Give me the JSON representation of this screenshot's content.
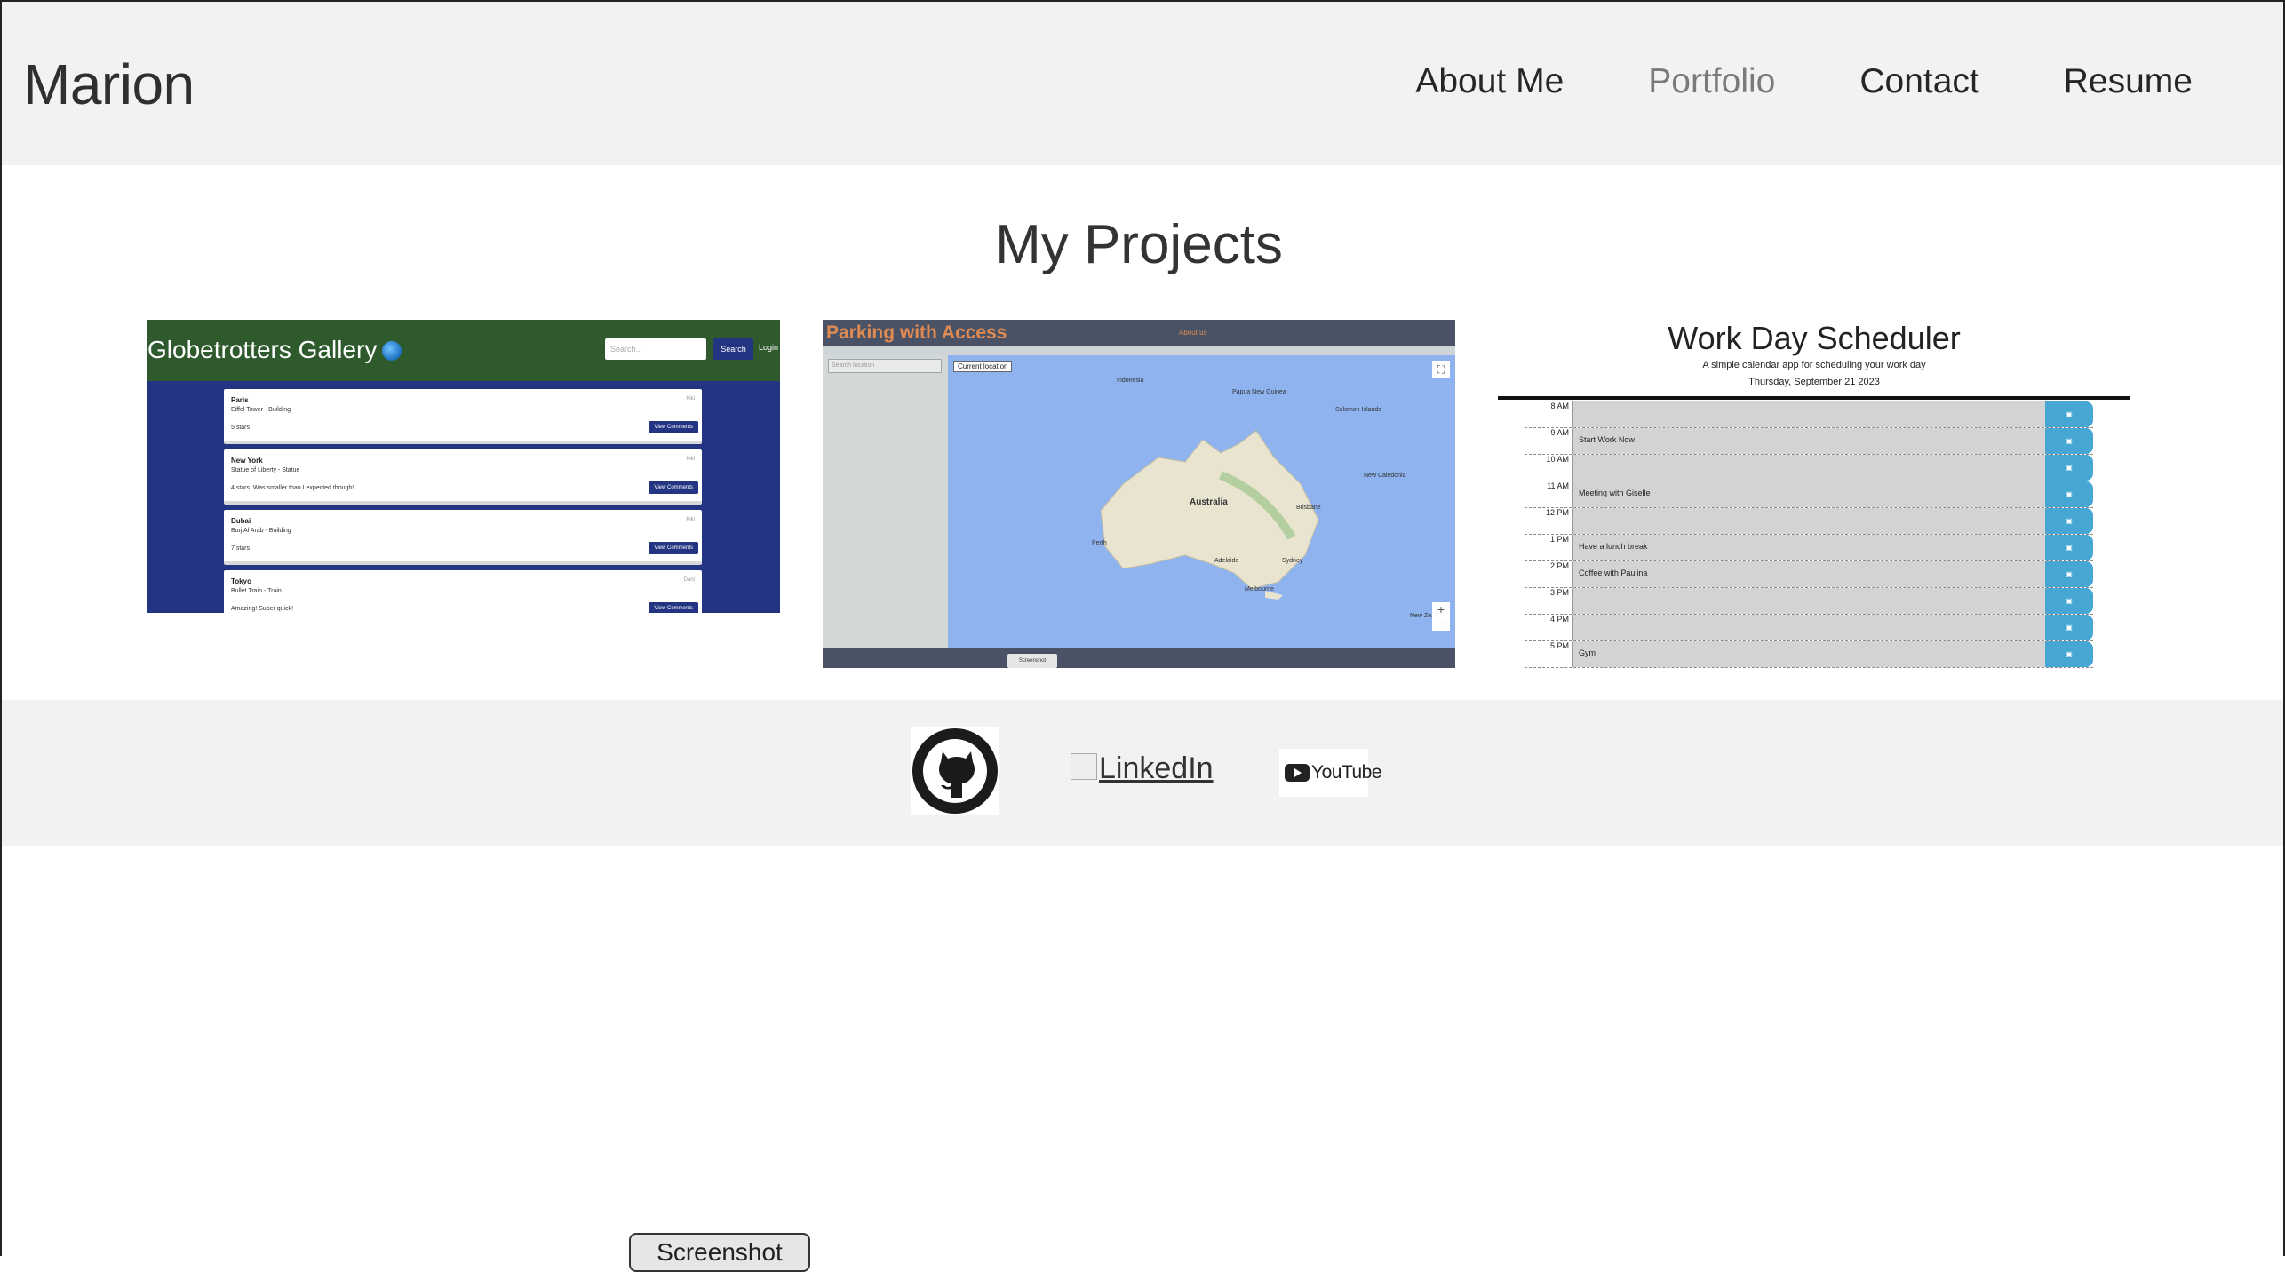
{
  "brand": "Marion",
  "nav": {
    "about": "About Me",
    "portfolio": "Portfolio",
    "contact": "Contact",
    "resume": "Resume",
    "active": "Portfolio",
    "active_color": "#7a7a7a"
  },
  "projects": {
    "heading": "My Projects",
    "globetrotters": {
      "title": "Globetrotters Gallery",
      "search_placeholder": "Search...",
      "search_button": "Search",
      "login": "Login",
      "items": [
        {
          "city": "Paris",
          "subtitle": "Eiffel Tower - Building",
          "review": "5 stars",
          "author": "Kiki",
          "button": "View Comments"
        },
        {
          "city": "New York",
          "subtitle": "Statue of Liberty - Statue",
          "review": "4 stars. Was smaller than I expected though!",
          "author": "Kiki",
          "button": "View Comments"
        },
        {
          "city": "Dubai",
          "subtitle": "Burj Al Arab - Building",
          "review": "7 stars",
          "author": "Kiki",
          "button": "View Comments"
        },
        {
          "city": "Tokyo",
          "subtitle": "Bullet Train - Train",
          "review": "Amazing! Super quick!",
          "author": "Dani",
          "button": "View Comments"
        }
      ]
    },
    "parking": {
      "title": "Parking with Access",
      "about": "About us",
      "search_placeholder": "Search location",
      "current_location": "Current location",
      "map_labels": [
        "Indonesia",
        "Papua New Guinea",
        "Solomon Islands",
        "Australia",
        "New Caledonia",
        "New Zealand",
        "Sydney",
        "Brisbane",
        "Perth",
        "Adelaide",
        "Melbourne"
      ],
      "screenshot_label": "Screenshot"
    },
    "scheduler": {
      "title": "Work Day Scheduler",
      "subtitle": "A simple calendar app for scheduling your work day",
      "date": "Thursday, September 21 2023",
      "rows": [
        {
          "hour": "8 AM",
          "task": ""
        },
        {
          "hour": "9 AM",
          "task": "Start Work Now"
        },
        {
          "hour": "10 AM",
          "task": ""
        },
        {
          "hour": "11 AM",
          "task": "Meeting with Giselle"
        },
        {
          "hour": "12 PM",
          "task": ""
        },
        {
          "hour": "1 PM",
          "task": "Have a lunch break"
        },
        {
          "hour": "2 PM",
          "task": "Coffee with Paulina"
        },
        {
          "hour": "3 PM",
          "task": ""
        },
        {
          "hour": "4 PM",
          "task": ""
        },
        {
          "hour": "5 PM",
          "task": "Gym"
        }
      ]
    }
  },
  "footer": {
    "github_icon": "github-icon",
    "linkedin": "LinkedIn",
    "youtube": "YouTube"
  },
  "screenshot_button": "Screenshot"
}
